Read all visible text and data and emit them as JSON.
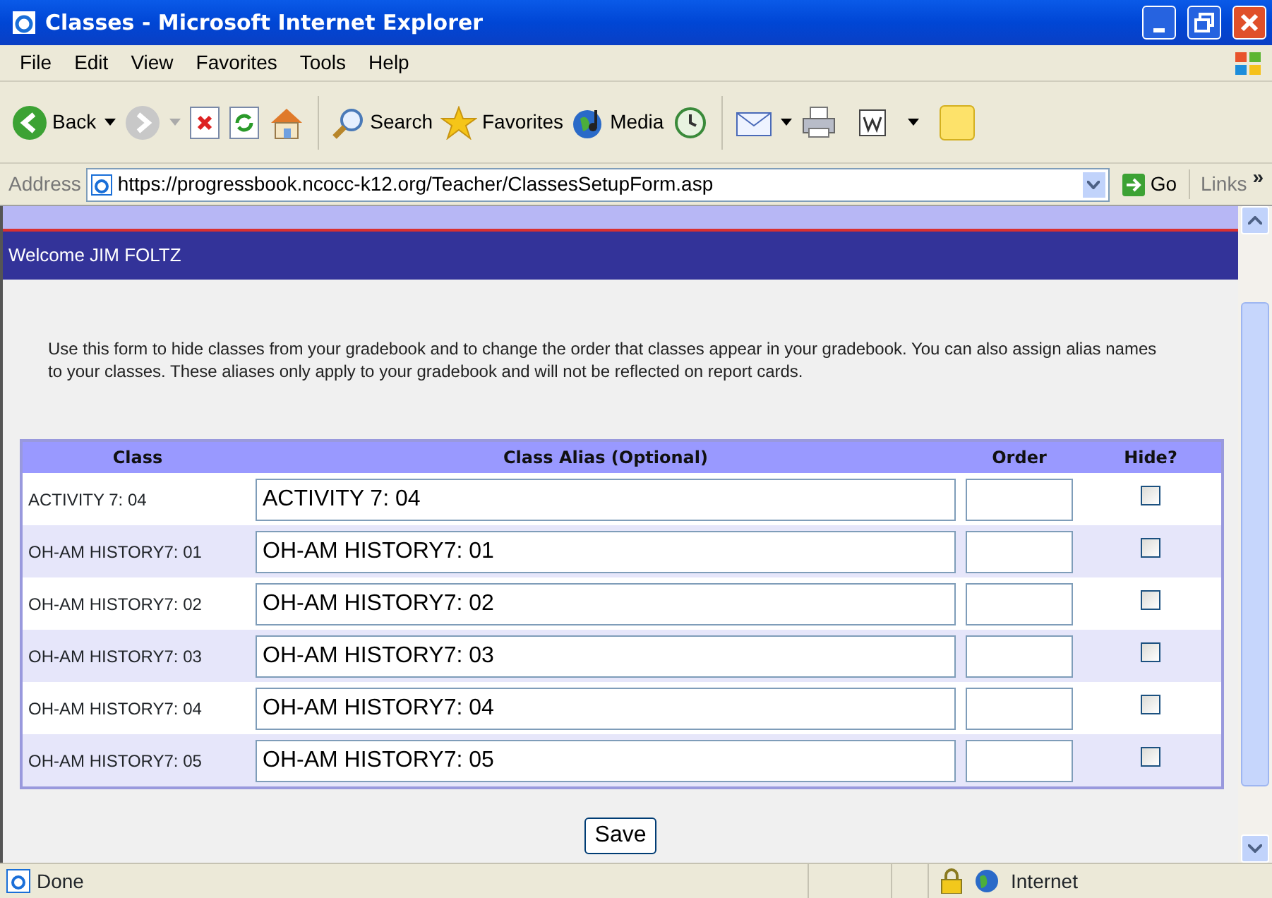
{
  "window": {
    "title": "Classes - Microsoft Internet Explorer"
  },
  "menu": [
    "File",
    "Edit",
    "View",
    "Favorites",
    "Tools",
    "Help"
  ],
  "toolbar": {
    "back": "Back",
    "search": "Search",
    "favorites": "Favorites",
    "media": "Media"
  },
  "address_bar": {
    "label": "Address",
    "url": "https://progressbook.ncocc-k12.org/Teacher/ClassesSetupForm.asp",
    "go": "Go",
    "links": "Links",
    "more": "»"
  },
  "page": {
    "welcome": "Welcome JIM FOLTZ",
    "instructions": "Use this form to hide classes from your gradebook and to change the order that classes appear in your gradebook. You can also assign alias names to your classes. These aliases only apply to your gradebook and will not be reflected on report cards.",
    "table": {
      "columns": [
        "Class",
        "Class Alias (Optional)",
        "Order",
        "Hide?"
      ],
      "rows": [
        {
          "class": "ACTIVITY 7: 04",
          "alias": "ACTIVITY 7: 04",
          "hide": false
        },
        {
          "class": "OH-AM HISTORY7: 01",
          "alias": "OH-AM HISTORY7: 01",
          "hide": false
        },
        {
          "class": "OH-AM HISTORY7: 02",
          "alias": "OH-AM HISTORY7: 02",
          "hide": false
        },
        {
          "class": "OH-AM HISTORY7: 03",
          "alias": "OH-AM HISTORY7: 03",
          "hide": false
        },
        {
          "class": "OH-AM HISTORY7: 04",
          "alias": "OH-AM HISTORY7: 04",
          "hide": false
        },
        {
          "class": "OH-AM HISTORY7: 05",
          "alias": "OH-AM HISTORY7: 05",
          "hide": false
        }
      ]
    },
    "save": "Save"
  },
  "status_bar": {
    "text": "Done",
    "zone": "Internet"
  }
}
